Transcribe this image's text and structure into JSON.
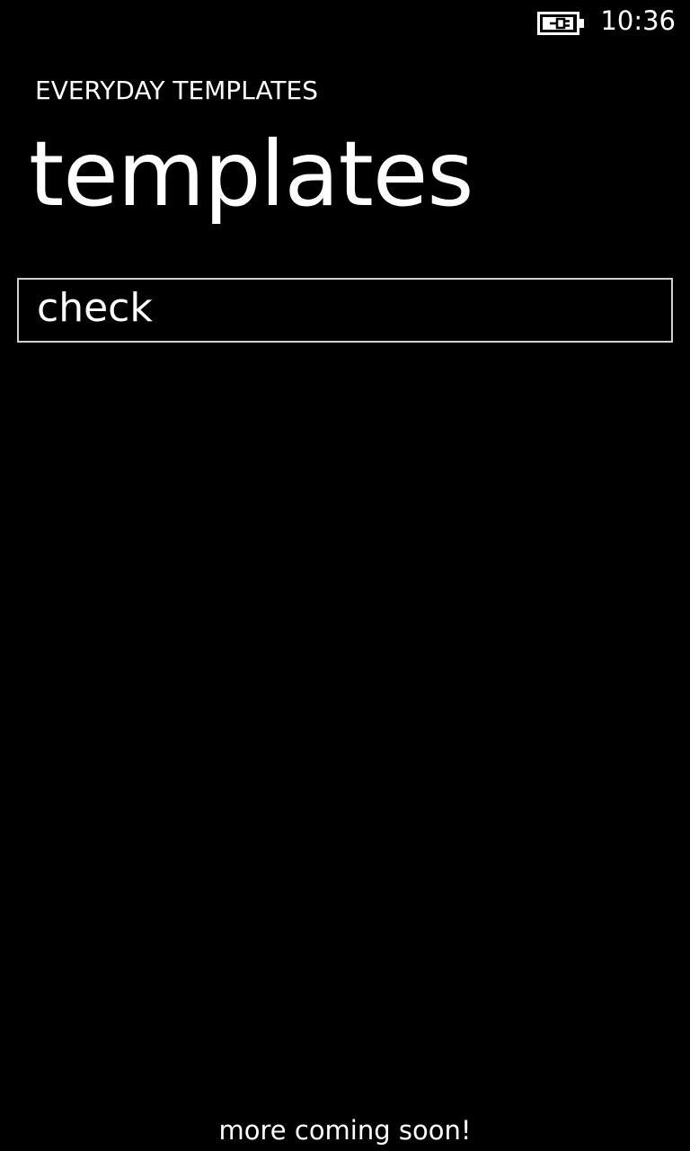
{
  "status_bar": {
    "battery_icon": "battery-charging-icon",
    "time": "10:36"
  },
  "header": {
    "app_title": "EVERYDAY TEMPLATES",
    "page_title": "templates"
  },
  "templates": {
    "items": [
      {
        "label": "check"
      }
    ]
  },
  "footer": {
    "note": "more coming soon!"
  },
  "colors": {
    "background": "#000000",
    "foreground": "#ffffff",
    "border": "#d0d0d0"
  }
}
